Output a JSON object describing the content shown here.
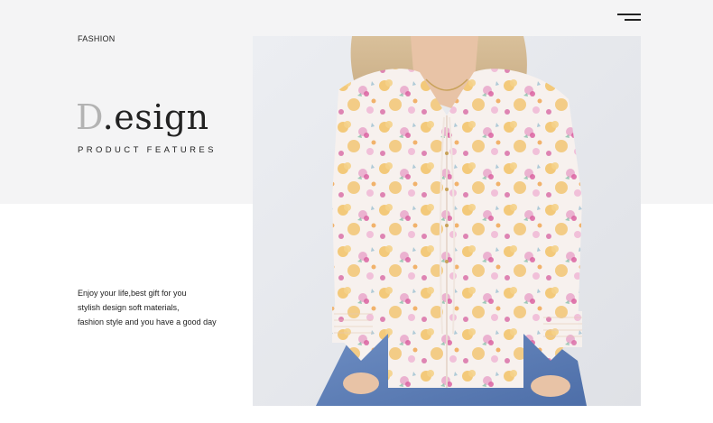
{
  "header": {
    "fashion_label": "FASHION",
    "menu_icon": "hamburger-menu-icon"
  },
  "hero": {
    "title_initial": "D",
    "title_dot": ".",
    "title_rest": "esign",
    "subtitle": "PRODUCT FEATURES"
  },
  "description": {
    "lines": [
      "Enjoy your life,best gift for you",
      "stylish design soft materials,",
      "fashion style and you have a good day"
    ]
  },
  "colors": {
    "top_band": "#f4f4f5",
    "text": "#222222",
    "title_initial": "#b3b3b3"
  }
}
